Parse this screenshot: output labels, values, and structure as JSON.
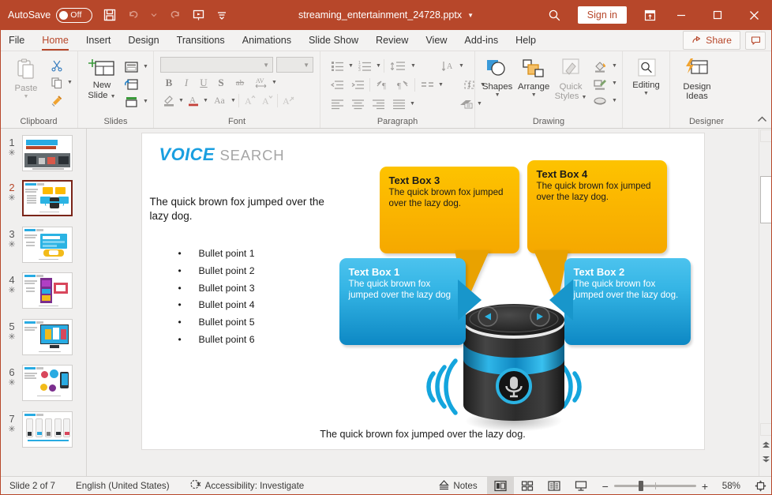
{
  "titlebar": {
    "autosave_label": "AutoSave",
    "autosave_state": "Off",
    "document_title": "streaming_entertainment_24728.pptx",
    "signin_label": "Sign in",
    "icons": [
      "save-icon",
      "undo-icon",
      "redo-icon",
      "start-presentation-icon",
      "customize-quick-access-toolbar-icon",
      "search-icon",
      "ribbon-display-options-icon",
      "minimize-icon",
      "maximize-icon",
      "close-icon"
    ]
  },
  "ribbon_tabs": {
    "tabs": [
      "File",
      "Home",
      "Insert",
      "Design",
      "Transitions",
      "Animations",
      "Slide Show",
      "Review",
      "View",
      "Add-ins",
      "Help"
    ],
    "active": "Home",
    "share_label": "Share",
    "comment_label": ""
  },
  "ribbon": {
    "groups": [
      {
        "name": "Clipboard",
        "label": "Clipboard"
      },
      {
        "name": "Slides",
        "label": "Slides"
      },
      {
        "name": "Font",
        "label": "Font"
      },
      {
        "name": "Paragraph",
        "label": "Paragraph"
      },
      {
        "name": "Drawing",
        "label": "Drawing"
      },
      {
        "name": "Designer",
        "label": "Designer"
      }
    ],
    "clipboard": {
      "paste_label": "Paste"
    },
    "slides": {
      "new_slide_label_1": "New",
      "new_slide_label_2": "Slide"
    },
    "font": {
      "font_name_value": "",
      "font_size_value": ""
    },
    "drawing": {
      "shapes_label": "Shapes",
      "arrange_label": "Arrange",
      "quick_styles_label_1": "Quick",
      "quick_styles_label_2": "Styles"
    },
    "designer": {
      "editing_label": "Editing",
      "design_ideas_label_1": "Design",
      "design_ideas_label_2": "Ideas"
    }
  },
  "thumbnails": [
    {
      "number": "1",
      "selected": false
    },
    {
      "number": "2",
      "selected": true
    },
    {
      "number": "3",
      "selected": false
    },
    {
      "number": "4",
      "selected": false
    },
    {
      "number": "5",
      "selected": false
    },
    {
      "number": "6",
      "selected": false
    },
    {
      "number": "7",
      "selected": false
    }
  ],
  "slide": {
    "title_primary": "VOICE",
    "title_secondary": "SEARCH",
    "body_text": "The quick brown fox jumped over the lazy dog.",
    "bullets": [
      "Bullet point 1",
      "Bullet point 2",
      "Bullet point 3",
      "Bullet point 4",
      "Bullet point 5",
      "Bullet point 6"
    ],
    "caption": "The quick brown fox jumped over the lazy dog.",
    "callouts": [
      {
        "id": "text-box-3",
        "title": "Text Box 3",
        "text": "The quick brown fox jumped over the lazy dog.",
        "color": "#fcba00"
      },
      {
        "id": "text-box-4",
        "title": "Text Box 4",
        "text": "The quick brown fox jumped over the lazy dog.",
        "color": "#fcba00"
      },
      {
        "id": "text-box-1",
        "title": "Text Box 1",
        "text": "The quick brown fox jumped over the lazy dog",
        "color": "#2bb3e3"
      },
      {
        "id": "text-box-2",
        "title": "Text Box 2",
        "text": "The quick brown fox jumped over the lazy dog.",
        "color": "#2bb3e3"
      }
    ]
  },
  "status": {
    "slide_counter": "Slide 2 of 7",
    "language": "English (United States)",
    "accessibility": "Accessibility: Investigate",
    "notes_label": "Notes",
    "zoom_percent": "58%",
    "views": [
      "normal-view",
      "slide-sorter-view",
      "reading-view",
      "slide-show-view"
    ],
    "active_view": "normal-view"
  },
  "colors": {
    "accent": "#b7472a",
    "slide_blue": "#29abe2",
    "callout_yellow": "#fcba00",
    "callout_blue": "#2bb3e3"
  }
}
